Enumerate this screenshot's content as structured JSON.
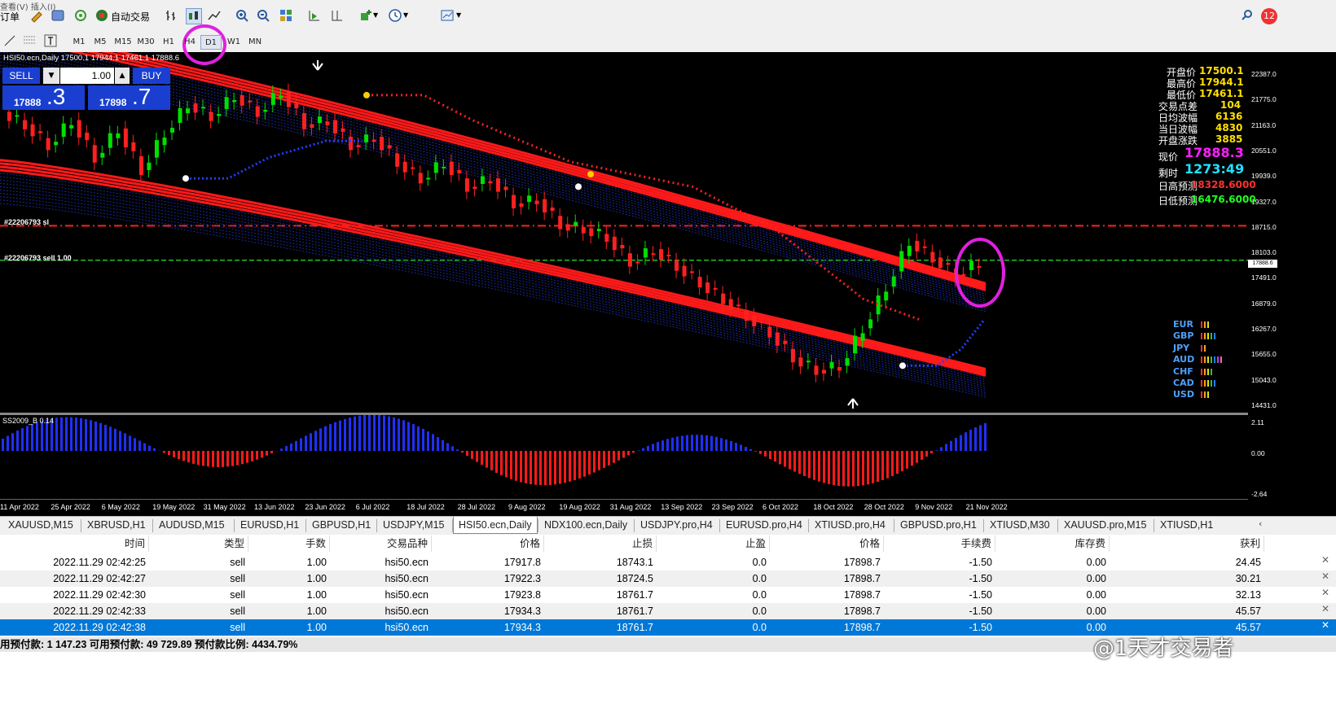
{
  "toolbar": {
    "order_label": "订单",
    "auto_trade_label": "自动交易",
    "menu_fragment": "查看(V)    插入(I)",
    "notification_badge": "12"
  },
  "timeframes": [
    "M1",
    "M5",
    "M15",
    "M30",
    "H1",
    "H4",
    "D1",
    "W1",
    "MN"
  ],
  "active_timeframe": "D1",
  "chart": {
    "header": "HSI50.ecn,Daily  17500.1 17944.1 17461.1 17888.6",
    "order_label_1": "#22206793 sl",
    "order_label_2": "#22206793 sell 1.00",
    "price_levels": [
      "22387.0",
      "21775.0",
      "21163.0",
      "20551.0",
      "19939.0",
      "19327.0",
      "18715.0",
      "18103.0",
      "17491.0",
      "16879.0",
      "16267.0",
      "15655.0",
      "15043.0",
      "14431.0"
    ],
    "current_price_tag": "17888.6",
    "date_labels": [
      "11 Apr 2022",
      "25 Apr 2022",
      "6 May 2022",
      "19 May 2022",
      "31 May 2022",
      "13 Jun 2022",
      "23 Jun 2022",
      "6 Jul 2022",
      "18 Jul 2022",
      "28 Jul 2022",
      "9 Aug 2022",
      "19 Aug 2022",
      "31 Aug 2022",
      "13 Sep 2022",
      "23 Sep 2022",
      "6 Oct 2022",
      "18 Oct 2022",
      "28 Oct 2022",
      "9 Nov 2022",
      "21 Nov 2022"
    ],
    "indicator_label": "SS2009_B 0.14",
    "indicator_levels": [
      "2.11",
      "0.00",
      "-2.64"
    ]
  },
  "order_panel": {
    "sell_label": "SELL",
    "buy_label": "BUY",
    "lot": "1.00",
    "sell_price_main": "17888",
    "sell_price_big": ".3",
    "buy_price_main": "17898",
    "buy_price_big": ".7"
  },
  "info_panel": {
    "open_label": "开盘价",
    "open_value": "17500.1",
    "high_label": "最高价",
    "high_value": "17944.1",
    "low_label": "最低价",
    "low_value": "17461.1",
    "spread_label": "交易点差",
    "spread_value": "104",
    "avg_range_label": "日均波幅",
    "avg_range_value": "6136",
    "today_range_label": "当日波幅",
    "today_range_value": "4830",
    "open_change_label": "开盘涨跌",
    "open_change_value": "3885",
    "price_label": "现价",
    "price_value": "17888.3",
    "time_label": "剩时",
    "time_value": "1273:49",
    "day_high_label": "日高预测",
    "day_high_value": "18328.6000",
    "day_low_label": "日低预测",
    "day_low_value": "16476.6000"
  },
  "currencies": [
    "EUR",
    "GBP",
    "JPY",
    "AUD",
    "CHF",
    "CAD",
    "USD"
  ],
  "tabs": [
    "XAUUSD,M15",
    "XBRUSD,H1",
    "AUDUSD,M15",
    "EURUSD,H1",
    "GBPUSD,H1",
    "USDJPY,M15",
    "HSI50.ecn,Daily",
    "NDX100.ecn,Daily",
    "USDJPY.pro,H4",
    "EURUSD.pro,H4",
    "XTIUSD.pro,H4",
    "GBPUSD.pro,H1",
    "XTIUSD,M30",
    "XAUUSD.pro,M15",
    "XTIUSD,H1"
  ],
  "active_tab": "HSI50.ecn,Daily",
  "table": {
    "headers": [
      "时间",
      "类型",
      "手数",
      "交易品种",
      "价格",
      "止损",
      "止盈",
      "价格",
      "手续费",
      "库存费",
      "获利"
    ],
    "rows": [
      [
        "2022.11.29 02:42:25",
        "sell",
        "1.00",
        "hsi50.ecn",
        "17917.8",
        "18743.1",
        "0.0",
        "17898.7",
        "-1.50",
        "0.00",
        "24.45"
      ],
      [
        "2022.11.29 02:42:27",
        "sell",
        "1.00",
        "hsi50.ecn",
        "17922.3",
        "18724.5",
        "0.0",
        "17898.7",
        "-1.50",
        "0.00",
        "30.21"
      ],
      [
        "2022.11.29 02:42:30",
        "sell",
        "1.00",
        "hsi50.ecn",
        "17923.8",
        "18761.7",
        "0.0",
        "17898.7",
        "-1.50",
        "0.00",
        "32.13"
      ],
      [
        "2022.11.29 02:42:33",
        "sell",
        "1.00",
        "hsi50.ecn",
        "17934.3",
        "18761.7",
        "0.0",
        "17898.7",
        "-1.50",
        "0.00",
        "45.57"
      ],
      [
        "2022.11.29 02:42:38",
        "sell",
        "1.00",
        "hsi50.ecn",
        "17934.3",
        "18761.7",
        "0.0",
        "17898.7",
        "-1.50",
        "0.00",
        "45.57"
      ]
    ]
  },
  "status": {
    "text": "用预付款: 1 147.23  可用预付款: 49 729.89  预付款比例: 4434.79%"
  },
  "watermark": "@1天才交易者",
  "colors": {
    "bull": "#00e000",
    "bear": "#ff2020",
    "channel": "#ff1a1a",
    "highlight": "#e020e0",
    "panel_blue": "#1a3fd0"
  }
}
